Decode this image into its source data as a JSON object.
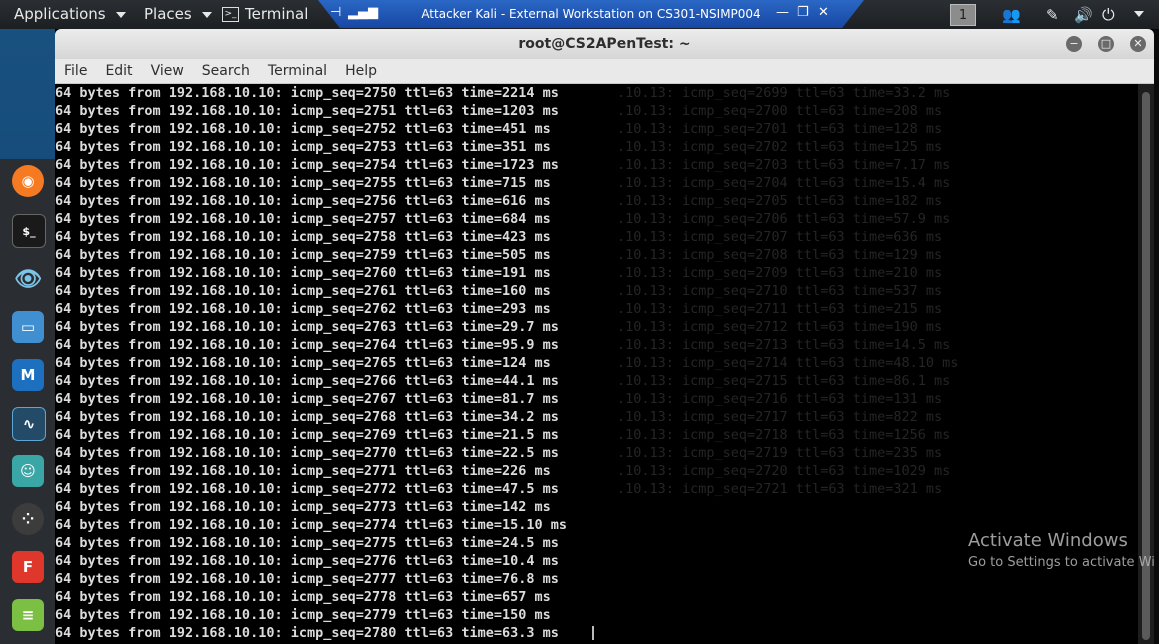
{
  "top_panel": {
    "applications": "Applications",
    "places": "Places",
    "terminal": "Terminal",
    "rdp_title": "Attacker Kali - External Workstation on CS301-NSIMP004",
    "workspace": "1"
  },
  "dock": {
    "icons": [
      "firefox-icon",
      "terminal-app-icon",
      "eye-icon",
      "files-icon",
      "metasploit-icon",
      "armitage-icon",
      "maltego-icon",
      "cherrytree-icon",
      "burpsuite-icon",
      "leafpad-icon"
    ]
  },
  "window": {
    "title": "root@CS2APenTest: ~",
    "menu": [
      "File",
      "Edit",
      "View",
      "Search",
      "Terminal",
      "Help"
    ]
  },
  "terminal": {
    "lines": [
      "64 bytes from 192.168.10.10: icmp_seq=2750 ttl=63 time=2214 ms",
      "64 bytes from 192.168.10.10: icmp_seq=2751 ttl=63 time=1203 ms",
      "64 bytes from 192.168.10.10: icmp_seq=2752 ttl=63 time=451 ms",
      "64 bytes from 192.168.10.10: icmp_seq=2753 ttl=63 time=351 ms",
      "64 bytes from 192.168.10.10: icmp_seq=2754 ttl=63 time=1723 ms",
      "64 bytes from 192.168.10.10: icmp_seq=2755 ttl=63 time=715 ms",
      "64 bytes from 192.168.10.10: icmp_seq=2756 ttl=63 time=616 ms",
      "64 bytes from 192.168.10.10: icmp_seq=2757 ttl=63 time=684 ms",
      "64 bytes from 192.168.10.10: icmp_seq=2758 ttl=63 time=423 ms",
      "64 bytes from 192.168.10.10: icmp_seq=2759 ttl=63 time=505 ms",
      "64 bytes from 192.168.10.10: icmp_seq=2760 ttl=63 time=191 ms",
      "64 bytes from 192.168.10.10: icmp_seq=2761 ttl=63 time=160 ms",
      "64 bytes from 192.168.10.10: icmp_seq=2762 ttl=63 time=293 ms",
      "64 bytes from 192.168.10.10: icmp_seq=2763 ttl=63 time=29.7 ms",
      "64 bytes from 192.168.10.10: icmp_seq=2764 ttl=63 time=95.9 ms",
      "64 bytes from 192.168.10.10: icmp_seq=2765 ttl=63 time=124 ms",
      "64 bytes from 192.168.10.10: icmp_seq=2766 ttl=63 time=44.1 ms",
      "64 bytes from 192.168.10.10: icmp_seq=2767 ttl=63 time=81.7 ms",
      "64 bytes from 192.168.10.10: icmp_seq=2768 ttl=63 time=34.2 ms",
      "64 bytes from 192.168.10.10: icmp_seq=2769 ttl=63 time=21.5 ms",
      "64 bytes from 192.168.10.10: icmp_seq=2770 ttl=63 time=22.5 ms",
      "64 bytes from 192.168.10.10: icmp_seq=2771 ttl=63 time=226 ms",
      "64 bytes from 192.168.10.10: icmp_seq=2772 ttl=63 time=47.5 ms",
      "64 bytes from 192.168.10.10: icmp_seq=2773 ttl=63 time=142 ms",
      "64 bytes from 192.168.10.10: icmp_seq=2774 ttl=63 time=15.10 ms",
      "64 bytes from 192.168.10.10: icmp_seq=2775 ttl=63 time=24.5 ms",
      "64 bytes from 192.168.10.10: icmp_seq=2776 ttl=63 time=10.4 ms",
      "64 bytes from 192.168.10.10: icmp_seq=2777 ttl=63 time=76.8 ms",
      "64 bytes from 192.168.10.10: icmp_seq=2778 ttl=63 time=657 ms",
      "64 bytes from 192.168.10.10: icmp_seq=2779 ttl=63 time=150 ms",
      "64 bytes from 192.168.10.10: icmp_seq=2780 ttl=63 time=63.3 ms"
    ],
    "ghost_lines": [
      ".10.13: icmp_seq=2699 ttl=63 time=33.2 ms",
      ".10.13: icmp_seq=2700 ttl=63 time=208 ms",
      ".10.13: icmp_seq=2701 ttl=63 time=128 ms",
      ".10.13: icmp_seq=2702 ttl=63 time=125 ms",
      ".10.13: icmp_seq=2703 ttl=63 time=7.17 ms",
      ".10.13: icmp_seq=2704 ttl=63 time=15.4 ms",
      ".10.13: icmp_seq=2705 ttl=63 time=182 ms",
      ".10.13: icmp_seq=2706 ttl=63 time=57.9 ms",
      ".10.13: icmp_seq=2707 ttl=63 time=636 ms",
      ".10.13: icmp_seq=2708 ttl=63 time=129 ms",
      ".10.13: icmp_seq=2709 ttl=63 time=210 ms",
      ".10.13: icmp_seq=2710 ttl=63 time=537 ms",
      ".10.13: icmp_seq=2711 ttl=63 time=215 ms",
      ".10.13: icmp_seq=2712 ttl=63 time=190 ms",
      ".10.13: icmp_seq=2713 ttl=63 time=14.5 ms",
      ".10.13: icmp_seq=2714 ttl=63 time=48.10 ms",
      ".10.13: icmp_seq=2715 ttl=63 time=86.1 ms",
      ".10.13: icmp_seq=2716 ttl=63 time=131 ms",
      ".10.13: icmp_seq=2717 ttl=63 time=822 ms",
      ".10.13: icmp_seq=2718 ttl=63 time=1256 ms",
      ".10.13: icmp_seq=2719 ttl=63 time=235 ms",
      ".10.13: icmp_seq=2720 ttl=63 time=1029 ms",
      ".10.13: icmp_seq=2721 ttl=63 time=321 ms"
    ]
  },
  "watermark": {
    "title": "Activate Windows",
    "subtitle": "Go to Settings to activate Wi"
  }
}
